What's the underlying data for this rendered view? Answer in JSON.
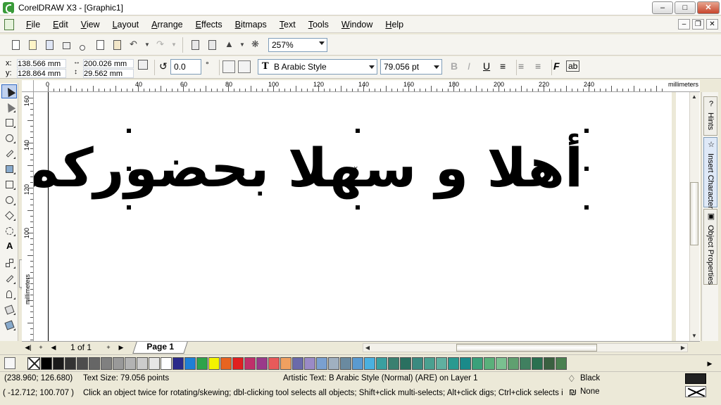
{
  "window": {
    "title": "CorelDRAW X3 - [Graphic1]",
    "minimize": "–",
    "maximize": "□",
    "close": "✕"
  },
  "menu": {
    "items": [
      "File",
      "Edit",
      "View",
      "Layout",
      "Arrange",
      "Effects",
      "Bitmaps",
      "Text",
      "Tools",
      "Window",
      "Help"
    ],
    "doc_minimize": "–",
    "doc_restore": "❐",
    "doc_close": "✕"
  },
  "toolbar": {
    "zoom_value": "257%"
  },
  "propbar": {
    "x_label": "x:",
    "x_value": "138.566 mm",
    "y_label": "y:",
    "y_value": "128.864 mm",
    "width_value": "200.026 mm",
    "height_value": "29.562 mm",
    "angle_value": "0.0",
    "angle_unit": "°",
    "font_name": "B Arabic Style",
    "font_size": "79.056 pt"
  },
  "ruler": {
    "unit": "millimeters",
    "h_ticks": [
      "0",
      "40",
      "60",
      "80",
      "100",
      "120",
      "140",
      "160",
      "180",
      "200",
      "220",
      "240"
    ],
    "v_ticks": [
      "160",
      "140",
      "120",
      "100"
    ]
  },
  "canvas": {
    "text_content": "أهلا و سهلا بحضوركم"
  },
  "docker": {
    "tabs": [
      "Hints",
      "Insert Character",
      "Object Properties"
    ]
  },
  "page_nav": {
    "count_label": "1 of 1",
    "page_tab": "Page 1"
  },
  "palette": {
    "colors": [
      "#000000",
      "#1a1a1a",
      "#333333",
      "#4d4d4d",
      "#666666",
      "#808080",
      "#999999",
      "#b3b3b3",
      "#cccccc",
      "#e6e6e6",
      "#ffffff",
      "#2a2a8a",
      "#1e7fd6",
      "#2ea34a",
      "#f4f400",
      "#e86420",
      "#e02020",
      "#c0306a",
      "#9a3a8a",
      "#e85a5a",
      "#f0a060",
      "#6a6aaa",
      "#9a8ac6",
      "#7aa0d0",
      "#a0b0c0",
      "#6a8aa0",
      "#5a9ad0",
      "#4ab0e0",
      "#3aa0a0",
      "#3a8070",
      "#2a7060",
      "#3a8a80",
      "#4aa090",
      "#60b0a0",
      "#2a9a90",
      "#1a8a8a",
      "#3aa07a",
      "#5ab07a",
      "#7ac090",
      "#60a070",
      "#408060",
      "#2a7050",
      "#3a6040",
      "#4a8050"
    ],
    "scroll_right": "▶"
  },
  "status": {
    "coords_1": "(238.960; 126.680)",
    "text_size": "Text Size: 79.056 points",
    "object_info": "Artistic Text: B Arabic Style (Normal) (ARE) on Layer 1",
    "coords_2": "( -12.712; 100.707 )",
    "hint": "Click an object twice for rotating/skewing; dbl-clicking tool selects all objects; Shift+click multi-selects; Alt+click digs; Ctrl+click selects in a gr...",
    "fill_name": "Black",
    "outline_name": "None"
  }
}
